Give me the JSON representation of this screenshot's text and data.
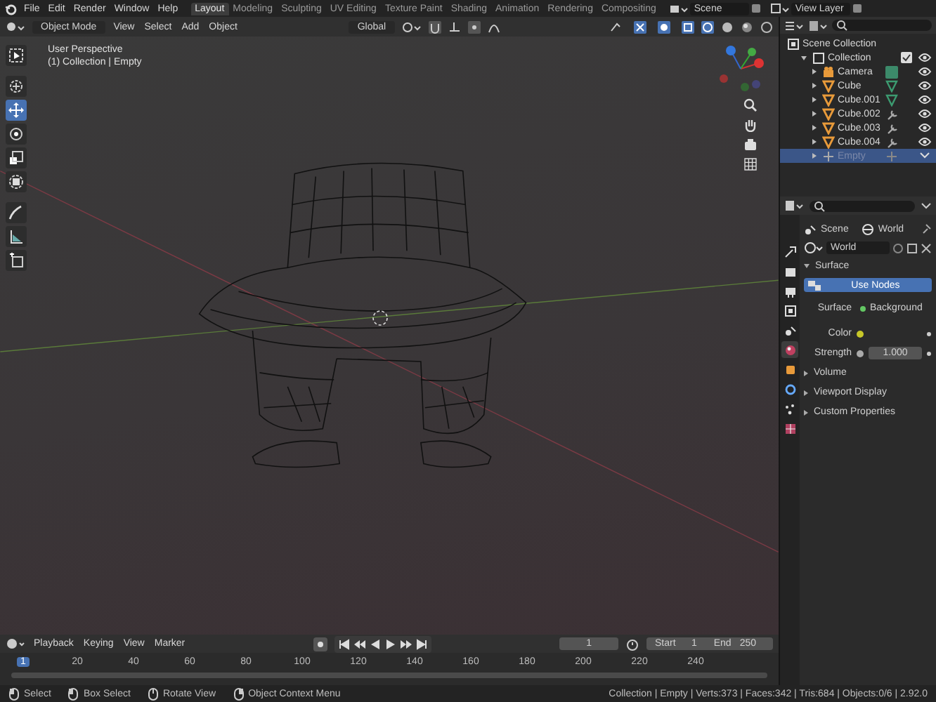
{
  "menu": [
    "File",
    "Edit",
    "Render",
    "Window",
    "Help"
  ],
  "workspaces": [
    {
      "label": "Layout",
      "selected": true
    },
    {
      "label": "Modeling",
      "selected": false
    },
    {
      "label": "Sculpting",
      "selected": false
    },
    {
      "label": "UV Editing",
      "selected": false
    },
    {
      "label": "Texture Paint",
      "selected": false
    },
    {
      "label": "Shading",
      "selected": false
    },
    {
      "label": "Animation",
      "selected": false
    },
    {
      "label": "Rendering",
      "selected": false
    },
    {
      "label": "Compositing",
      "selected": false
    }
  ],
  "scene": "Scene",
  "view_layer": "View Layer",
  "viewport_header": {
    "mode": "Object Mode",
    "menus": [
      "View",
      "Select",
      "Add",
      "Object"
    ],
    "orientation": "Global"
  },
  "toolbar": [
    {
      "selected": false
    },
    {
      "selected": false
    },
    {
      "selected": true
    },
    {
      "selected": false
    },
    {
      "selected": false
    },
    {
      "selected": false
    },
    {
      "selected": false
    },
    {
      "selected": false
    },
    {
      "selected": false
    }
  ],
  "viewport": {
    "perspective": "User Perspective",
    "context": "(1) Collection | Empty"
  },
  "outliner": {
    "items": [
      {
        "label": "Scene Collection",
        "kind": "scene_collection",
        "selected": false,
        "children": [
          {
            "label": "Collection",
            "kind": "collection",
            "selected": false,
            "expanded": true,
            "children": [
              {
                "label": "Camera",
                "kind": "camera",
                "selected": false,
                "expanded": false
              },
              {
                "label": "Cube",
                "kind": "mesh",
                "selected": false,
                "expanded": false
              },
              {
                "label": "Cube.001",
                "kind": "mesh",
                "selected": false,
                "expanded": false
              },
              {
                "label": "Cube.002",
                "kind": "mesh",
                "selected": false,
                "expanded": false
              },
              {
                "label": "Cube.003",
                "kind": "mesh",
                "selected": false,
                "expanded": false
              },
              {
                "label": "Cube.004",
                "kind": "mesh",
                "selected": false,
                "expanded": false
              },
              {
                "label": "Empty",
                "kind": "empty",
                "selected": true,
                "expanded": false
              }
            ]
          }
        ]
      }
    ]
  },
  "properties": {
    "tabs": [
      {
        "selected": false
      },
      {
        "selected": false
      },
      {
        "selected": false
      },
      {
        "selected": false
      },
      {
        "selected": false
      },
      {
        "selected": true
      },
      {
        "selected": false
      },
      {
        "selected": false
      },
      {
        "selected": false
      },
      {
        "selected": false
      }
    ],
    "breadcrumb": [
      "Scene",
      "World"
    ],
    "datablock": "World",
    "panels": [
      {
        "label": "Surface",
        "expanded": true
      },
      {
        "label": "Volume",
        "expanded": false
      },
      {
        "label": "Viewport Display",
        "expanded": false
      },
      {
        "label": "Custom Properties",
        "expanded": false
      }
    ],
    "use_nodes": "Use Nodes",
    "surface_label": "Surface",
    "surface_value": "Background",
    "color_label": "Color",
    "strength_label": "Strength",
    "strength_value": "1.000"
  },
  "timeline": {
    "menus": [
      "Playback",
      "Keying",
      "View",
      "Marker"
    ],
    "current_frame": "1",
    "start_label": "Start",
    "start": "1",
    "end_label": "End",
    "end": "250",
    "playhead": "1",
    "ticks": [
      "20",
      "40",
      "60",
      "80",
      "100",
      "120",
      "140",
      "160",
      "180",
      "200",
      "220",
      "240"
    ]
  },
  "status_bar": {
    "hints": [
      "Select",
      "Box Select",
      "Rotate View",
      "Object Context Menu"
    ],
    "stats": "Collection | Empty | Verts:373 | Faces:342 | Tris:684 | Objects:0/6 | 2.92.0"
  }
}
